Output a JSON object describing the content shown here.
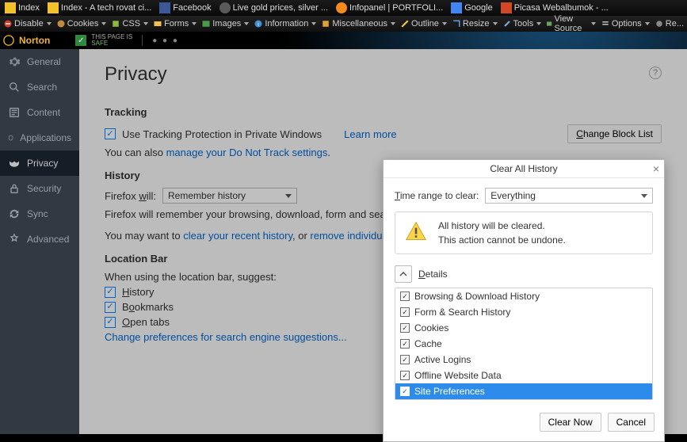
{
  "bookmarks": [
    {
      "label": "Index",
      "iconClass": "fi-y"
    },
    {
      "label": "Index - A tech rovat ci...",
      "iconClass": "fi-y"
    },
    {
      "label": "Facebook",
      "iconClass": "fi-b"
    },
    {
      "label": "Live gold prices, silver ...",
      "iconClass": "fi-g"
    },
    {
      "label": "Infopanel | PORTFOLI...",
      "iconClass": "fi-o"
    },
    {
      "label": "Google",
      "iconClass": "fi-go"
    },
    {
      "label": "Picasa Webalbumok - ...",
      "iconClass": "fi-p"
    }
  ],
  "devtools": [
    "Disable",
    "Cookies",
    "CSS",
    "Forms",
    "Images",
    "Information",
    "Miscellaneous",
    "Outline",
    "Resize",
    "Tools",
    "View Source",
    "Options",
    "Re..."
  ],
  "norton": {
    "brand": "Norton",
    "page_is": "THIS PAGE IS",
    "safe": "SAFE"
  },
  "sidebar": {
    "items": [
      {
        "label": "General"
      },
      {
        "label": "Search"
      },
      {
        "label": "Content"
      },
      {
        "label": "Applications"
      },
      {
        "label": "Privacy"
      },
      {
        "label": "Security"
      },
      {
        "label": "Sync"
      },
      {
        "label": "Advanced"
      }
    ]
  },
  "privacy": {
    "title": "Privacy",
    "tracking_heading": "Tracking",
    "use_tp": "Use Tracking Protection in Private Windows",
    "learn_more": "Learn more",
    "change_block": "Change Block List",
    "also_text": "You can also ",
    "dnt_link": "manage your Do Not Track settings",
    "history_heading": "History",
    "fx_will_label": "Firefox will:",
    "fx_will_value": "Remember history",
    "remember_text": "Firefox will remember your browsing, download, form and search history, an",
    "maywant": "You may want to ",
    "clear_recent": "clear your recent history",
    "or": ", or ",
    "remove_cookies": "remove individual cookies",
    "locbar_heading": "Location Bar",
    "locbar_sub": "When using the location bar, suggest:",
    "history": "History",
    "bookmarks": "Bookmarks",
    "opentabs": "Open tabs",
    "change_search": "Change preferences for search engine suggestions..."
  },
  "dialog": {
    "title": "Clear All History",
    "range_label": "Time range to clear:",
    "range_value": "Everything",
    "warn1": "All history will be cleared.",
    "warn2": "This action cannot be undone.",
    "details": "Details",
    "items": [
      "Browsing & Download History",
      "Form & Search History",
      "Cookies",
      "Cache",
      "Active Logins",
      "Offline Website Data",
      "Site Preferences"
    ],
    "clear_now": "Clear Now",
    "cancel": "Cancel"
  }
}
